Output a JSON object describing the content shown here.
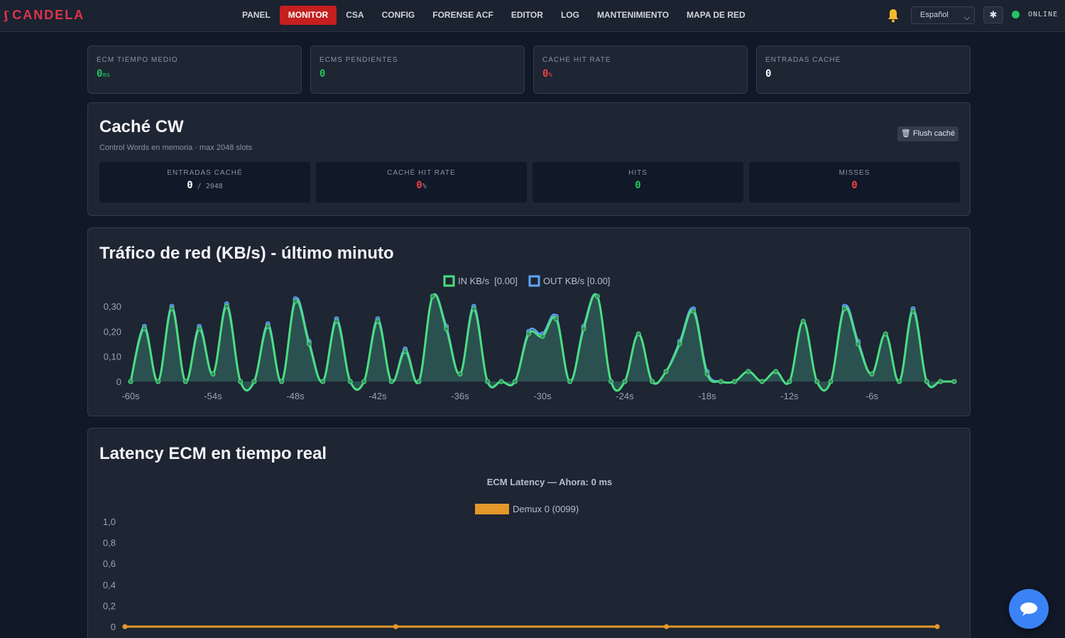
{
  "brand": {
    "icon": "ʃ",
    "name": "CANDELA"
  },
  "nav": {
    "items": [
      {
        "label": "PANEL"
      },
      {
        "label": "MONITOR",
        "active": true
      },
      {
        "label": "CSA"
      },
      {
        "label": "CONFIG"
      },
      {
        "label": "FORENSE ACF"
      },
      {
        "label": "EDITOR"
      },
      {
        "label": "LOG"
      },
      {
        "label": "MANTENIMIENTO"
      },
      {
        "label": "MAPA DE RED"
      }
    ]
  },
  "header": {
    "language": "Español",
    "theme_icon": "✱",
    "status": "ONLINE",
    "status_color": "#22c55e"
  },
  "stats": [
    {
      "label": "ECM TIEMPO MEDIO",
      "value": "0",
      "unit": "ms",
      "color": "green"
    },
    {
      "label": "ECMS PENDIENTES",
      "value": "0",
      "unit": "",
      "color": "green"
    },
    {
      "label": "CACHÉ HIT RATE",
      "value": "0",
      "unit": "%",
      "color": "red"
    },
    {
      "label": "ENTRADAS CACHÉ",
      "value": "0",
      "unit": "",
      "color": "white"
    }
  ],
  "cache_panel": {
    "title": "Caché CW",
    "subtitle": "Control Words en memoria · max 2048 slots",
    "flush_label": "🗑 Flush caché",
    "cards": [
      {
        "label": "ENTRADAS CACHÉ",
        "value": "0",
        "suffix": " / 2048",
        "color": "white"
      },
      {
        "label": "CACHÉ HIT RATE",
        "value": "0",
        "suffix": "%",
        "color": "red"
      },
      {
        "label": "HITS",
        "value": "0",
        "suffix": "",
        "color": "green"
      },
      {
        "label": "MISSES",
        "value": "0",
        "suffix": "",
        "color": "red"
      }
    ]
  },
  "chart_data": [
    {
      "type": "area",
      "title": "Tráfico de red (KB/s) - último minuto",
      "legend_placement": "top-center",
      "ylim": [
        0,
        0.34
      ],
      "yticks": [
        "0",
        "0,10",
        "0,20",
        "0,30"
      ],
      "ytick_values": [
        0,
        0.1,
        0.2,
        0.3
      ],
      "xticks": [
        "-60s",
        "-54s",
        "-48s",
        "-42s",
        "-36s",
        "-30s",
        "-24s",
        "-18s",
        "-12s",
        "-6s"
      ],
      "xtick_values": [
        -60,
        -54,
        -48,
        -42,
        -36,
        -30,
        -24,
        -18,
        -12,
        -6
      ],
      "x": [
        -60,
        -59,
        -58,
        -57,
        -56,
        -55,
        -54,
        -53,
        -52,
        -51,
        -50,
        -49,
        -48,
        -47,
        -46,
        -45,
        -44,
        -43,
        -42,
        -41,
        -40,
        -39,
        -38,
        -37,
        -36,
        -35,
        -34,
        -33,
        -32,
        -31,
        -30,
        -29,
        -28,
        -27,
        -26,
        -25,
        -24,
        -23,
        -22,
        -21,
        -20,
        -19,
        -18,
        -17,
        -16,
        -15,
        -14,
        -13,
        -12,
        -11,
        -10,
        -9,
        -8,
        -7,
        -6,
        -5,
        -4,
        -3,
        -2,
        -1,
        0
      ],
      "grid": false,
      "series": [
        {
          "name": "IN KB/s  [0.00]",
          "color": "#4ade80",
          "values": [
            0,
            0.21,
            0,
            0.29,
            0,
            0.21,
            0.03,
            0.3,
            0,
            0,
            0.22,
            0,
            0.32,
            0.15,
            0,
            0.24,
            0,
            0,
            0.24,
            0,
            0.12,
            0,
            0.34,
            0.21,
            0.03,
            0.29,
            0,
            0,
            0,
            0.19,
            0.18,
            0.25,
            0,
            0.21,
            0.34,
            0,
            0,
            0.19,
            0,
            0.04,
            0.15,
            0.28,
            0.03,
            0,
            0,
            0.04,
            0,
            0.04,
            0,
            0.24,
            0,
            0,
            0.29,
            0.15,
            0.03,
            0.19,
            0,
            0.28,
            0,
            0,
            0
          ]
        },
        {
          "name": "OUT KB/s [0.00]",
          "color": "#60a5fa",
          "values": [
            0,
            0.22,
            0,
            0.3,
            0,
            0.22,
            0.03,
            0.31,
            0,
            0,
            0.23,
            0,
            0.33,
            0.16,
            0,
            0.25,
            0,
            0,
            0.25,
            0,
            0.13,
            0,
            0.34,
            0.22,
            0.03,
            0.3,
            0,
            0,
            0,
            0.2,
            0.19,
            0.26,
            0,
            0.22,
            0.34,
            0,
            0,
            0.19,
            0,
            0.04,
            0.16,
            0.29,
            0.04,
            0,
            0,
            0.04,
            0,
            0.04,
            0,
            0.24,
            0,
            0,
            0.3,
            0.16,
            0.03,
            0.19,
            0,
            0.29,
            0,
            0,
            0
          ]
        }
      ]
    },
    {
      "type": "line",
      "title": "Latency ECM en tiempo real",
      "subtitle": "ECM Latency — Ahora: 0 ms",
      "legend_placement": "top-center",
      "ylim": [
        0,
        1
      ],
      "yticks": [
        "0",
        "0,2",
        "0,4",
        "0,6",
        "0,8",
        "1,0"
      ],
      "ytick_values": [
        0,
        0.2,
        0.4,
        0.6,
        0.8,
        1.0
      ],
      "grid": false,
      "series": [
        {
          "name": "Demux 0 (0099)",
          "color": "#e5982a",
          "values": [
            0,
            0,
            0,
            0
          ]
        }
      ]
    }
  ],
  "chat_icon": "chat-bubble-icon"
}
